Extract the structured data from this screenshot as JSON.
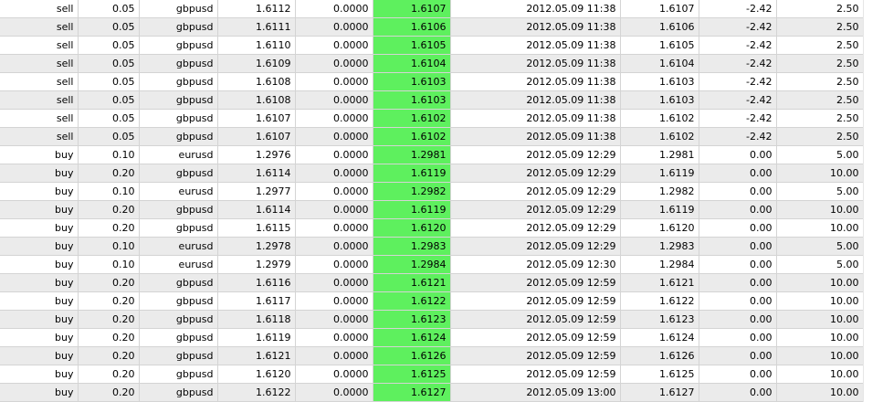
{
  "table": {
    "rows": [
      [
        "sell",
        "0.05",
        "gbpusd",
        "1.6112",
        "0.0000",
        "1.6107",
        "2012.05.09 11:38",
        "1.6107",
        "-2.42",
        "2.50"
      ],
      [
        "sell",
        "0.05",
        "gbpusd",
        "1.6111",
        "0.0000",
        "1.6106",
        "2012.05.09 11:38",
        "1.6106",
        "-2.42",
        "2.50"
      ],
      [
        "sell",
        "0.05",
        "gbpusd",
        "1.6110",
        "0.0000",
        "1.6105",
        "2012.05.09 11:38",
        "1.6105",
        "-2.42",
        "2.50"
      ],
      [
        "sell",
        "0.05",
        "gbpusd",
        "1.6109",
        "0.0000",
        "1.6104",
        "2012.05.09 11:38",
        "1.6104",
        "-2.42",
        "2.50"
      ],
      [
        "sell",
        "0.05",
        "gbpusd",
        "1.6108",
        "0.0000",
        "1.6103",
        "2012.05.09 11:38",
        "1.6103",
        "-2.42",
        "2.50"
      ],
      [
        "sell",
        "0.05",
        "gbpusd",
        "1.6108",
        "0.0000",
        "1.6103",
        "2012.05.09 11:38",
        "1.6103",
        "-2.42",
        "2.50"
      ],
      [
        "sell",
        "0.05",
        "gbpusd",
        "1.6107",
        "0.0000",
        "1.6102",
        "2012.05.09 11:38",
        "1.6102",
        "-2.42",
        "2.50"
      ],
      [
        "sell",
        "0.05",
        "gbpusd",
        "1.6107",
        "0.0000",
        "1.6102",
        "2012.05.09 11:38",
        "1.6102",
        "-2.42",
        "2.50"
      ],
      [
        "buy",
        "0.10",
        "eurusd",
        "1.2976",
        "0.0000",
        "1.2981",
        "2012.05.09 12:29",
        "1.2981",
        "0.00",
        "5.00"
      ],
      [
        "buy",
        "0.20",
        "gbpusd",
        "1.6114",
        "0.0000",
        "1.6119",
        "2012.05.09 12:29",
        "1.6119",
        "0.00",
        "10.00"
      ],
      [
        "buy",
        "0.10",
        "eurusd",
        "1.2977",
        "0.0000",
        "1.2982",
        "2012.05.09 12:29",
        "1.2982",
        "0.00",
        "5.00"
      ],
      [
        "buy",
        "0.20",
        "gbpusd",
        "1.6114",
        "0.0000",
        "1.6119",
        "2012.05.09 12:29",
        "1.6119",
        "0.00",
        "10.00"
      ],
      [
        "buy",
        "0.20",
        "gbpusd",
        "1.6115",
        "0.0000",
        "1.6120",
        "2012.05.09 12:29",
        "1.6120",
        "0.00",
        "10.00"
      ],
      [
        "buy",
        "0.10",
        "eurusd",
        "1.2978",
        "0.0000",
        "1.2983",
        "2012.05.09 12:29",
        "1.2983",
        "0.00",
        "5.00"
      ],
      [
        "buy",
        "0.10",
        "eurusd",
        "1.2979",
        "0.0000",
        "1.2984",
        "2012.05.09 12:30",
        "1.2984",
        "0.00",
        "5.00"
      ],
      [
        "buy",
        "0.20",
        "gbpusd",
        "1.6116",
        "0.0000",
        "1.6121",
        "2012.05.09 12:59",
        "1.6121",
        "0.00",
        "10.00"
      ],
      [
        "buy",
        "0.20",
        "gbpusd",
        "1.6117",
        "0.0000",
        "1.6122",
        "2012.05.09 12:59",
        "1.6122",
        "0.00",
        "10.00"
      ],
      [
        "buy",
        "0.20",
        "gbpusd",
        "1.6118",
        "0.0000",
        "1.6123",
        "2012.05.09 12:59",
        "1.6123",
        "0.00",
        "10.00"
      ],
      [
        "buy",
        "0.20",
        "gbpusd",
        "1.6119",
        "0.0000",
        "1.6124",
        "2012.05.09 12:59",
        "1.6124",
        "0.00",
        "10.00"
      ],
      [
        "buy",
        "0.20",
        "gbpusd",
        "1.6121",
        "0.0000",
        "1.6126",
        "2012.05.09 12:59",
        "1.6126",
        "0.00",
        "10.00"
      ],
      [
        "buy",
        "0.20",
        "gbpusd",
        "1.6120",
        "0.0000",
        "1.6125",
        "2012.05.09 12:59",
        "1.6125",
        "0.00",
        "10.00"
      ],
      [
        "buy",
        "0.20",
        "gbpusd",
        "1.6122",
        "0.0000",
        "1.6127",
        "2012.05.09 13:00",
        "1.6127",
        "0.00",
        "10.00"
      ]
    ]
  },
  "colors": {
    "highlight": "#5ef05e",
    "row_alt": "#ebebeb",
    "row": "#ffffff",
    "grid_line": "#d4d4d4"
  }
}
